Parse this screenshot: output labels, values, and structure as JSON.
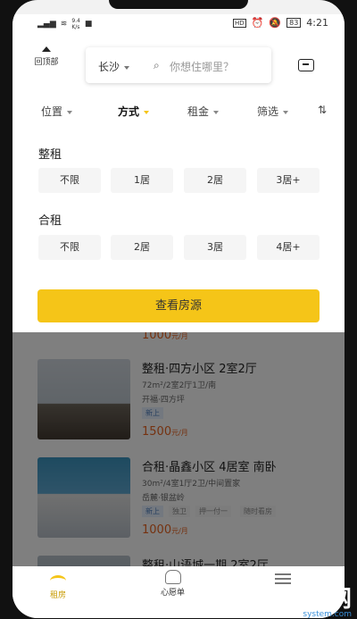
{
  "status": {
    "signal": "4G",
    "net_speed": "9.4\nK/s",
    "icons_right": [
      "HD",
      "alarm",
      "mute",
      "83"
    ],
    "time": "4:21"
  },
  "header": {
    "back_top_label": "回顶部",
    "city": "长沙",
    "search_placeholder": "你想住哪里？"
  },
  "filter_tabs": [
    {
      "label": "位置"
    },
    {
      "label": "方式"
    },
    {
      "label": "租金"
    },
    {
      "label": "筛选"
    },
    {
      "label": "⇅"
    }
  ],
  "panel": {
    "section1": "整租",
    "whole_rent_options": [
      "不限",
      "1居",
      "2居",
      "3居+"
    ],
    "section2": "合租",
    "shared_rent_options": [
      "不限",
      "2居",
      "3居",
      "4居+"
    ],
    "cta": "查看房源"
  },
  "listings": [
    {
      "price": "1000",
      "unit": "元/月"
    },
    {
      "title": "整租·四方小区 2室2厅",
      "detail": "72m²/2室2厅1卫/南",
      "location": "开福·四方坪",
      "tags": [
        "新上"
      ],
      "price": "1500",
      "unit": "元/月"
    },
    {
      "title": "合租·晶鑫小区 4居室 南卧",
      "detail": "30m²/4室1厅2卫/中间置家",
      "location": "岳麓·银盆岭",
      "tags": [
        "新上",
        "独卫",
        "押一付一",
        "随时看房"
      ],
      "price": "1000",
      "unit": "元/月"
    },
    {
      "title": "整租·山语城一期 2室2厅"
    }
  ],
  "bottom_nav": [
    {
      "label": "租房"
    },
    {
      "label": "心愿单"
    },
    {
      "label": ""
    }
  ],
  "watermark": {
    "brand": "GXI网",
    "domain": "system.com"
  },
  "colors": {
    "accent": "#f5c518",
    "price": "#e06020"
  }
}
